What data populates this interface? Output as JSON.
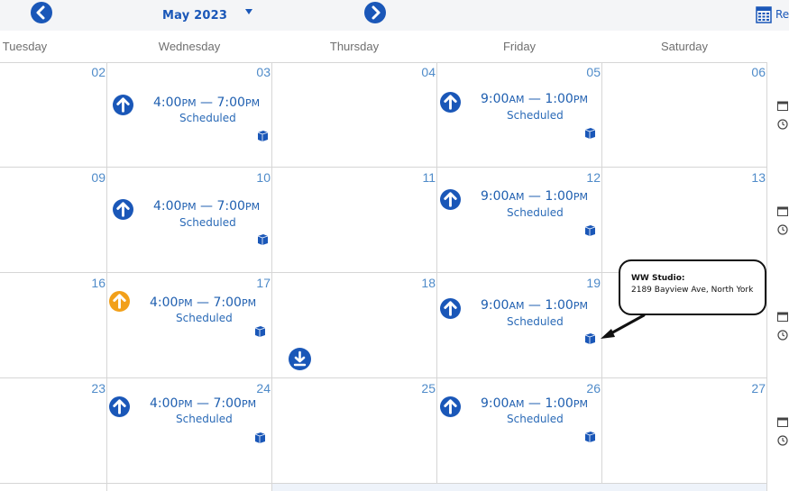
{
  "header": {
    "month": "May 2023",
    "top_right_label": "Re"
  },
  "day_names": [
    "Tuesday",
    "Wednesday",
    "Thursday",
    "Friday",
    "Saturday"
  ],
  "weeks": [
    {
      "dates": [
        "02",
        "03",
        "04",
        "05",
        "06"
      ]
    },
    {
      "dates": [
        "09",
        "10",
        "11",
        "12",
        "13"
      ]
    },
    {
      "dates": [
        "16",
        "17",
        "18",
        "19",
        "20"
      ]
    },
    {
      "dates": [
        "23",
        "24",
        "25",
        "26",
        "27"
      ]
    }
  ],
  "events": {
    "wed": [
      {
        "start": "4:00",
        "start_ampm": "PM",
        "sep": " — ",
        "end": "7:00",
        "end_ampm": "PM",
        "status": "Scheduled"
      },
      {
        "start": "4:00",
        "start_ampm": "PM",
        "sep": " — ",
        "end": "7:00",
        "end_ampm": "PM",
        "status": "Scheduled"
      },
      {
        "start": "4:00",
        "start_ampm": "PM",
        "sep": " — ",
        "end": "7:00",
        "end_ampm": "PM",
        "status": "Scheduled"
      },
      {
        "start": "4:00",
        "start_ampm": "PM",
        "sep": " — ",
        "end": "7:00",
        "end_ampm": "PM",
        "status": "Scheduled"
      }
    ],
    "fri": [
      {
        "start": "9:00",
        "start_ampm": "AM",
        "sep": " — ",
        "end": "1:00",
        "end_ampm": "PM",
        "status": "Scheduled"
      },
      {
        "start": "9:00",
        "start_ampm": "AM",
        "sep": " — ",
        "end": "1:00",
        "end_ampm": "PM",
        "status": "Scheduled"
      },
      {
        "start": "9:00",
        "start_ampm": "AM",
        "sep": " — ",
        "end": "1:00",
        "end_ampm": "PM",
        "status": "Scheduled"
      },
      {
        "start": "9:00",
        "start_ampm": "AM",
        "sep": " — ",
        "end": "1:00",
        "end_ampm": "PM",
        "status": "Scheduled"
      }
    ]
  },
  "callout": {
    "title": "WW Studio:",
    "address": "2189 Bayview Ave, North York"
  },
  "colors": {
    "primary": "#1a57b8",
    "warning": "#f2a01a",
    "grid": "#d6d6d6"
  }
}
